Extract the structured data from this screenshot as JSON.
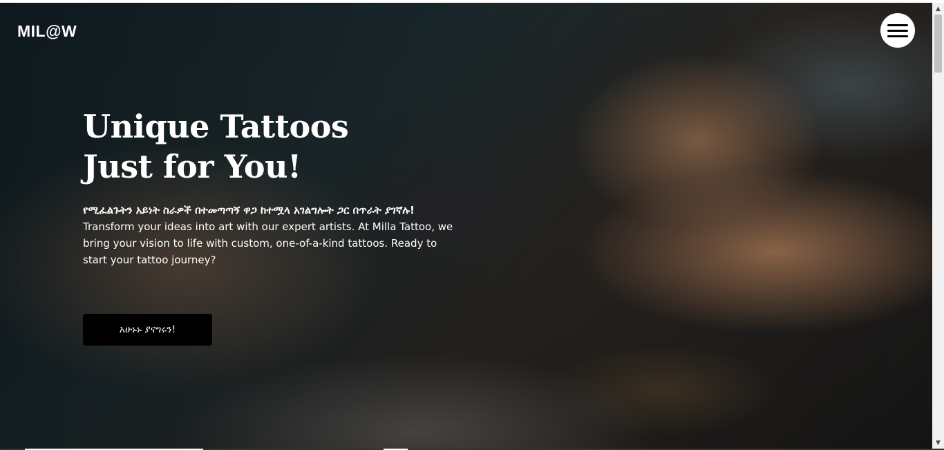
{
  "header": {
    "logo": "MIL@W",
    "menu_icon": "hamburger-menu-icon"
  },
  "hero": {
    "title": "Unique Tattoos Just for You!",
    "subtitle_amharic": "የሚፈልጉትን አይነት ስራዎች በተመጣጣኝ ዋጋ ከተሟላ አገልግሎት ጋር በጥራት ያገኛሉ!",
    "description": "Transform your ideas into art with our expert artists. At Milla Tattoo, we bring your vision to life with custom, one-of-a-kind tattoos. Ready to start your tattoo journey?",
    "cta_label": "አሁኑኑ ያናግሩን!"
  },
  "scrollbar": {
    "up_icon": "triangle-up-icon",
    "down_icon": "triangle-down-icon"
  },
  "colors": {
    "text": "#ffffff",
    "button_bg": "#000000",
    "menu_bg": "#ffffff"
  }
}
